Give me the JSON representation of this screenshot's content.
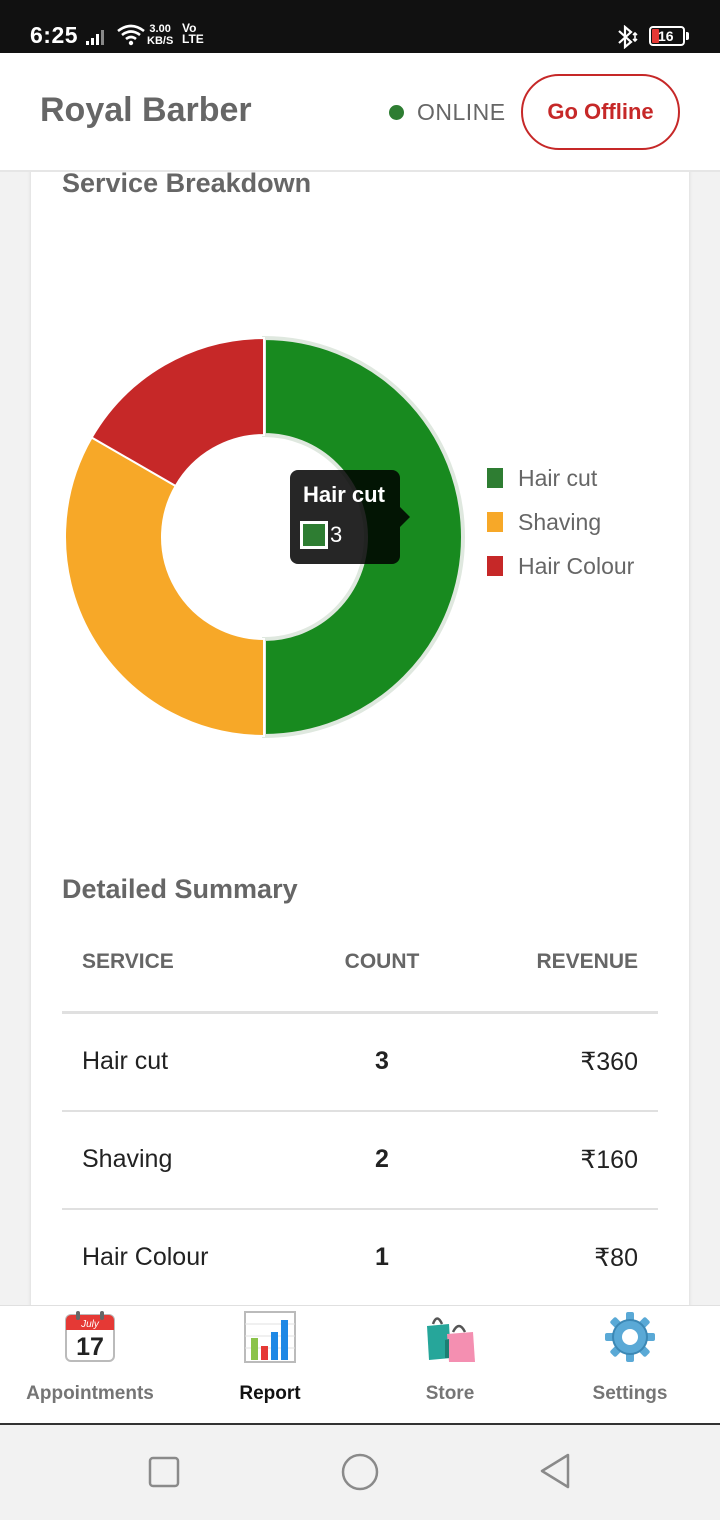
{
  "status_bar": {
    "time": "6:25",
    "speed_value": "3.00",
    "speed_unit": "KB/S",
    "volte_top": "Vo",
    "volte_bottom": "LTE",
    "battery": "16"
  },
  "header": {
    "title": "Royal Barber",
    "status_text": "ONLINE",
    "status_color": "#2e7d32",
    "action_button": "Go Offline",
    "action_color": "#c62828"
  },
  "breakdown": {
    "title": "Service Breakdown"
  },
  "chart_data": {
    "type": "pie",
    "style": "donut",
    "categories": [
      "Hair cut",
      "Shaving",
      "Hair Colour"
    ],
    "values": [
      3,
      2,
      1
    ],
    "colors": [
      "#188a1f",
      "#f7a828",
      "#c62828"
    ],
    "legend_colors": [
      "#2e7d32",
      "#f7a828",
      "#c62828"
    ],
    "legend_position": "right",
    "tooltip": {
      "label": "Hair cut",
      "value": "3"
    }
  },
  "summary": {
    "title": "Detailed Summary",
    "columns": [
      "SERVICE",
      "COUNT",
      "REVENUE"
    ],
    "rows": [
      {
        "service": "Hair cut",
        "count": "3",
        "revenue": "₹360"
      },
      {
        "service": "Shaving",
        "count": "2",
        "revenue": "₹160"
      },
      {
        "service": "Hair Colour",
        "count": "1",
        "revenue": "₹80"
      }
    ]
  },
  "bottom_nav": {
    "items": [
      {
        "label": "Appointments",
        "icon": "calendar-icon",
        "calendar_month": "July",
        "calendar_day": "17"
      },
      {
        "label": "Report",
        "icon": "bar-chart-icon",
        "active": true
      },
      {
        "label": "Store",
        "icon": "shopping-bags-icon"
      },
      {
        "label": "Settings",
        "icon": "gear-icon"
      }
    ]
  }
}
